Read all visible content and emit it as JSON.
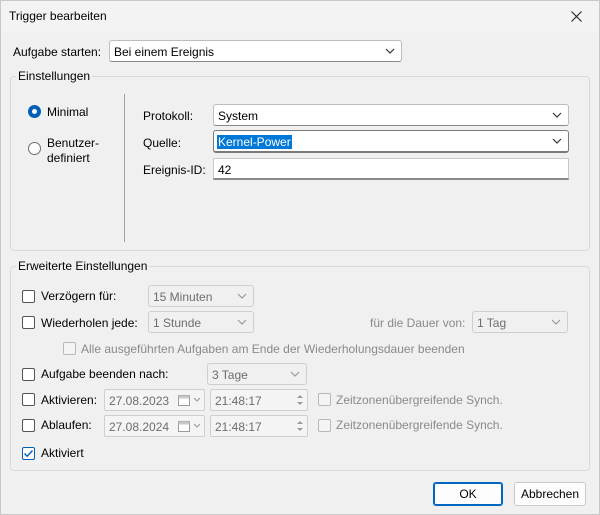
{
  "window": {
    "title": "Trigger bearbeiten"
  },
  "start_task": {
    "label": "Aufgabe starten:",
    "value": "Bei einem Ereignis"
  },
  "settings": {
    "group_title": "Einstellungen",
    "radio_minimal": "Minimal",
    "radio_custom_line1": "Benutzer-",
    "radio_custom_line2": "definiert",
    "protocol_label": "Protokoll:",
    "protocol_value": "System",
    "source_label": "Quelle:",
    "source_value": "Kernel-Power",
    "event_id_label": "Ereignis-ID:",
    "event_id_value": "42"
  },
  "advanced": {
    "group_title": "Erweiterte Einstellungen",
    "delay_label": "Verzögern für:",
    "delay_value": "15 Minuten",
    "repeat_label": "Wiederholen jede:",
    "repeat_value": "1 Stunde",
    "duration_label": "für die Dauer von:",
    "duration_value": "1 Tag",
    "stop_all_label": "Alle ausgeführten Aufgaben am Ende der Wiederholungsdauer beenden",
    "stop_after_label": "Aufgabe beenden nach:",
    "stop_after_value": "3 Tage",
    "activate_label": "Aktivieren:",
    "activate_date": "27.08.2023",
    "activate_time": "21:48:17",
    "activate_sync": "Zeitzonenübergreifende Synch.",
    "expire_label": "Ablaufen:",
    "expire_date": "27.08.2024",
    "expire_time": "21:48:17",
    "expire_sync": "Zeitzonenübergreifende Synch.",
    "enabled_label": "Aktiviert"
  },
  "buttons": {
    "ok": "OK",
    "cancel": "Abbrechen"
  },
  "colors": {
    "accent": "#005fb8",
    "selection": "#0078d7"
  }
}
